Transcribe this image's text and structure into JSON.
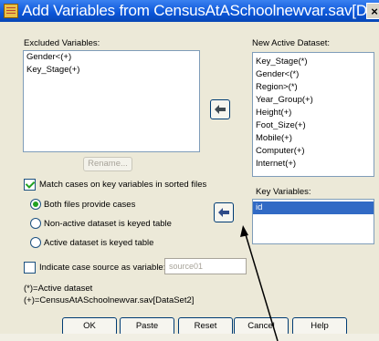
{
  "window": {
    "title": "Add Variables from CensusAtASchoolnewvar.sav[D...",
    "close_label": "×"
  },
  "excluded": {
    "label": "Excluded Variables:",
    "items": [
      "Gender<(+)",
      "Key_Stage(+)"
    ],
    "rename_label": "Rename..."
  },
  "active": {
    "label": "New Active Dataset:",
    "items": [
      "Key_Stage(*)",
      "Gender<(*)",
      "Region>(*)",
      "Year_Group(+)",
      "Height(+)",
      "Foot_Size(+)",
      "Mobile(+)",
      "Computer(+)",
      "Internet(+)"
    ]
  },
  "key": {
    "label": "Key Variables:",
    "items": [
      "id"
    ]
  },
  "match": {
    "label": "Match cases on key variables in sorted files",
    "checked": true
  },
  "options": [
    {
      "label": "Both files provide cases",
      "checked": true
    },
    {
      "label": "Non-active dataset is keyed table",
      "checked": false
    },
    {
      "label": "Active dataset is keyed table",
      "checked": false
    }
  ],
  "indicate": {
    "label": "Indicate case source as variable:",
    "placeholder": "source01",
    "checked": false
  },
  "legend": {
    "line1": "(*)=Active dataset",
    "line2": "(+)=CensusAtASchoolnewvar.sav[DataSet2]"
  },
  "buttons": {
    "ok": "OK",
    "paste": "Paste",
    "reset": "Reset",
    "cancel": "Cancel",
    "help": "Help"
  }
}
